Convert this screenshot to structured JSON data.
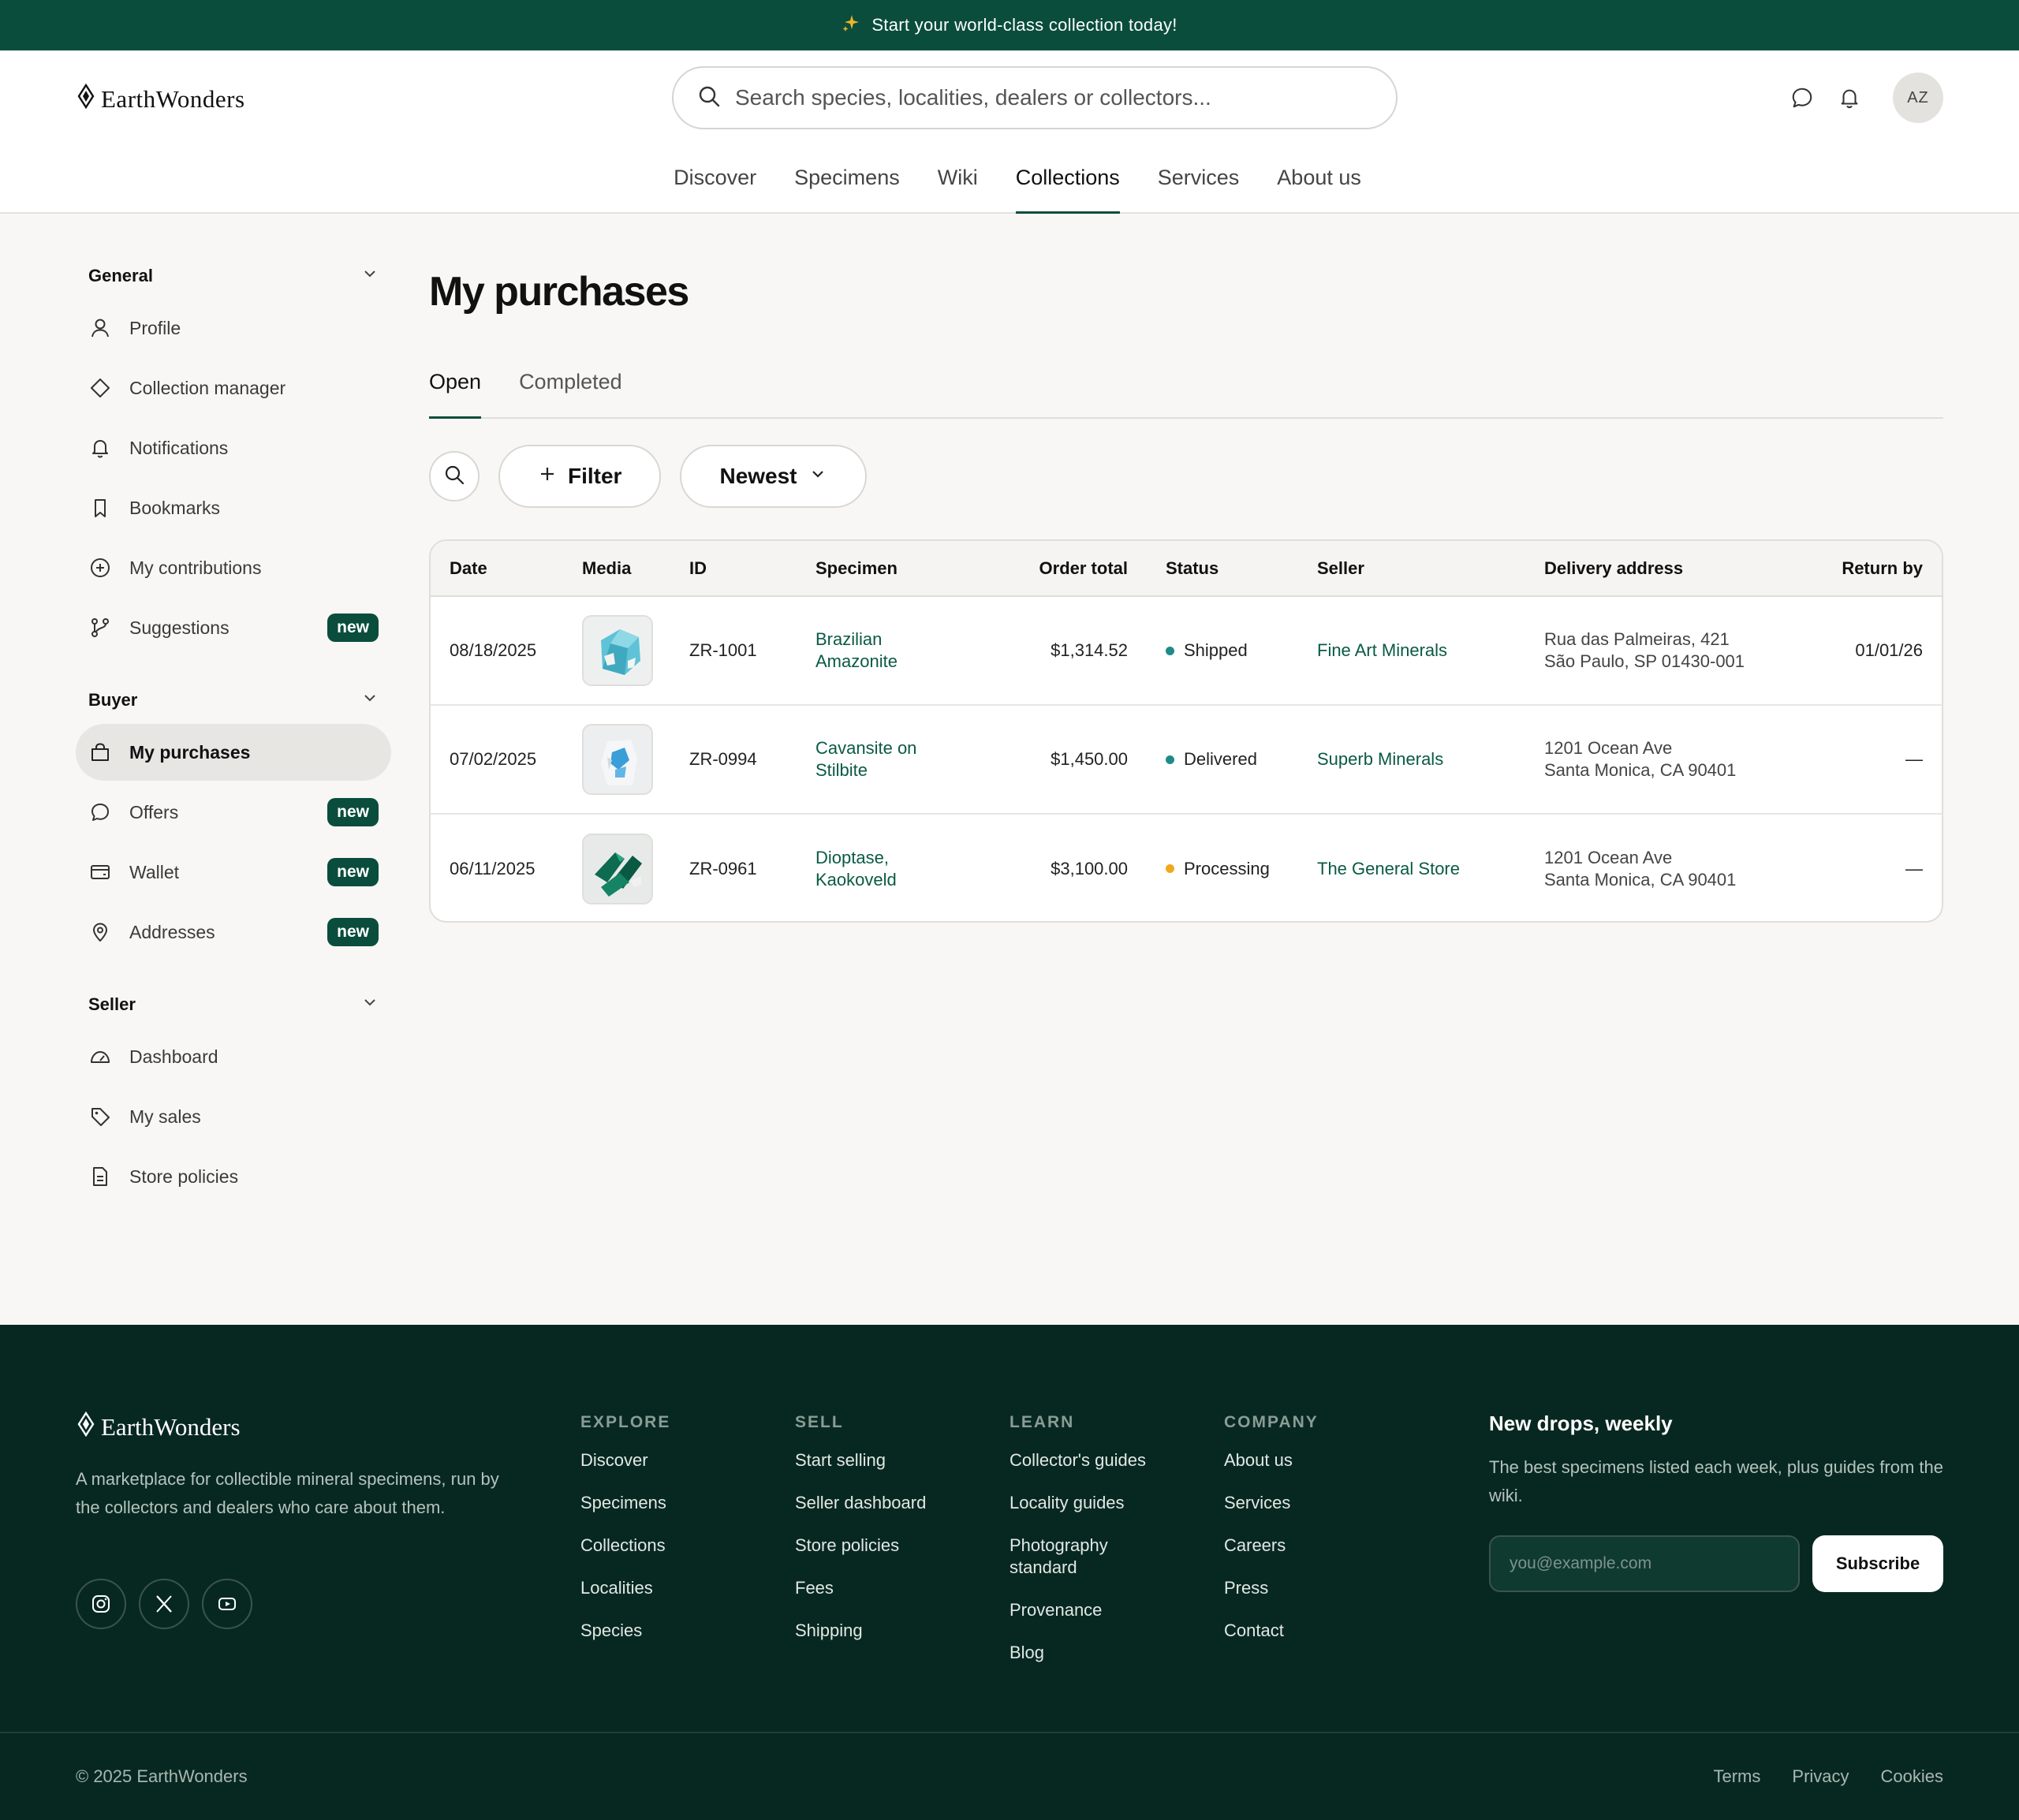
{
  "promo": {
    "text": "Start your world-class collection today!"
  },
  "brand": {
    "name": "EarthWonders"
  },
  "search": {
    "placeholder": "Search species, localities, dealers or collectors..."
  },
  "user": {
    "initials": "AZ"
  },
  "nav": {
    "items": [
      "Discover",
      "Specimens",
      "Wiki",
      "Collections",
      "Services",
      "About us"
    ],
    "active": "Collections"
  },
  "sidebar": {
    "general": {
      "title": "General",
      "items": [
        {
          "label": "Profile",
          "icon": "user-icon"
        },
        {
          "label": "Collection manager",
          "icon": "diamond-icon"
        },
        {
          "label": "Notifications",
          "icon": "bell-icon"
        },
        {
          "label": "Bookmarks",
          "icon": "bookmark-icon"
        },
        {
          "label": "My contributions",
          "icon": "plus-circle-icon"
        },
        {
          "label": "Suggestions",
          "icon": "git-branch-icon",
          "badge": "new"
        }
      ]
    },
    "buyer": {
      "title": "Buyer",
      "items": [
        {
          "label": "My purchases",
          "icon": "shopping-bag-icon",
          "active": true
        },
        {
          "label": "Offers",
          "icon": "chat-icon",
          "badge": "new"
        },
        {
          "label": "Wallet",
          "icon": "wallet-icon",
          "badge": "new"
        },
        {
          "label": "Addresses",
          "icon": "map-pin-icon",
          "badge": "new"
        }
      ]
    },
    "seller": {
      "title": "Seller",
      "items": [
        {
          "label": "Dashboard",
          "icon": "gauge-icon"
        },
        {
          "label": "My sales",
          "icon": "tag-icon"
        },
        {
          "label": "Store policies",
          "icon": "document-icon"
        }
      ]
    }
  },
  "main": {
    "title": "My purchases",
    "tabs": [
      "Open",
      "Completed"
    ],
    "active_tab": "Open",
    "filter_label": "Filter",
    "sort_label": "Newest",
    "columns": [
      "Date",
      "Media",
      "ID",
      "Specimen",
      "Order total",
      "Status",
      "Seller",
      "Delivery address",
      "Return by"
    ],
    "rows": [
      {
        "date": "08/18/2025",
        "id": "ZR-1001",
        "specimen": "Brazilian Amazonite",
        "total": "$1,314.52",
        "status": "Shipped",
        "status_color": "#1f8a8a",
        "seller": "Fine Art Minerals",
        "address_line1": "Rua das Palmeiras, 421",
        "address_line2": "São Paulo, SP 01430-001",
        "return_by": "01/01/26"
      },
      {
        "date": "07/02/2025",
        "id": "ZR-0994",
        "specimen": "Cavansite on Stilbite",
        "total": "$1,450.00",
        "status": "Delivered",
        "status_color": "#1f8a8a",
        "seller": "Superb Minerals",
        "address_line1": "1201 Ocean Ave",
        "address_line2": "Santa Monica, CA 90401",
        "return_by": "—"
      },
      {
        "date": "06/11/2025",
        "id": "ZR-0961",
        "specimen": "Dioptase, Kaokoveld",
        "total": "$3,100.00",
        "status": "Processing",
        "status_color": "#f0a81c",
        "seller": "The General Store",
        "address_line1": "1201 Ocean Ave",
        "address_line2": "Santa Monica, CA 90401",
        "return_by": "—"
      }
    ]
  },
  "footer": {
    "tagline": "A marketplace for collectible mineral specimens, run by the collectors and dealers who care about them.",
    "columns": [
      {
        "title": "EXPLORE",
        "links": [
          "Discover",
          "Specimens",
          "Collections",
          "Localities",
          "Species"
        ]
      },
      {
        "title": "SELL",
        "links": [
          "Start selling",
          "Seller dashboard",
          "Store policies",
          "Fees",
          "Shipping"
        ]
      },
      {
        "title": "LEARN",
        "links": [
          "Collector's guides",
          "Locality guides",
          "Photography standard",
          "Provenance",
          "Blog"
        ]
      },
      {
        "title": "COMPANY",
        "links": [
          "About us",
          "Services",
          "Careers",
          "Press",
          "Contact"
        ]
      }
    ],
    "newsletter": {
      "title": "New drops, weekly",
      "text": "The best specimens listed each week, plus guides from the wiki.",
      "placeholder": "you@example.com",
      "button": "Subscribe"
    },
    "copyright": "© 2025 EarthWonders",
    "legal": [
      "Terms",
      "Privacy",
      "Cookies"
    ]
  },
  "colors": {
    "brand_green": "#0a4d3c",
    "footer_bg": "#072820",
    "link_green": "#0a5a44"
  }
}
